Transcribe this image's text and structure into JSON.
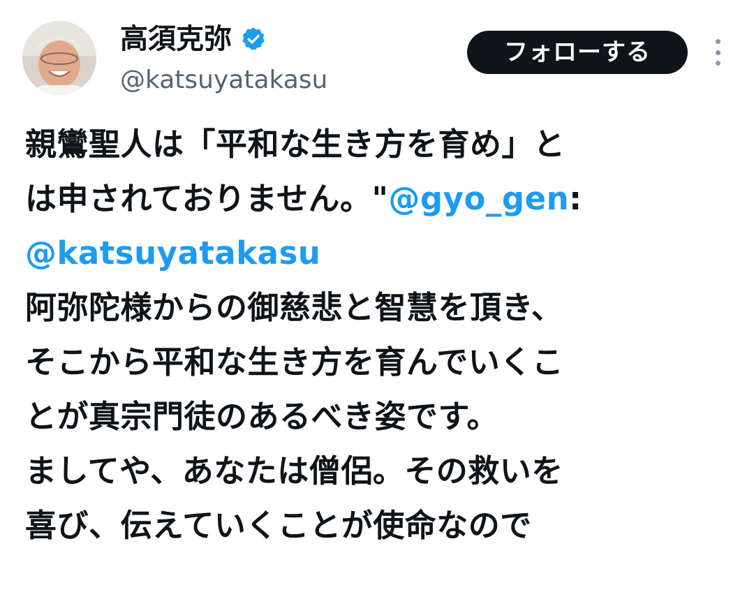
{
  "tweet": {
    "author": {
      "display_name": "高須克弥",
      "handle": "@katsuyatakasu",
      "verified": true,
      "avatar_icon": "profile-photo"
    },
    "follow_label": "フォローする",
    "more_icon": "more-vertical-icon",
    "body_lines": [
      {
        "segments": [
          {
            "text": "親鸞聖人は「平和な生き方を育め」と"
          }
        ]
      },
      {
        "segments": [
          {
            "text": "は申されておりません。\""
          },
          {
            "text": "@gyo_gen",
            "mention": true
          },
          {
            "text": ":"
          }
        ]
      },
      {
        "segments": [
          {
            "text": "@katsuyatakasu",
            "mention": true
          }
        ]
      },
      {
        "segments": [
          {
            "text": "阿弥陀様からの御慈悲と智慧を頂き、"
          }
        ]
      },
      {
        "segments": [
          {
            "text": "そこから平和な生き方を育んでいくこ"
          }
        ]
      },
      {
        "segments": [
          {
            "text": "とが真宗門徒のあるべき姿です。"
          }
        ]
      },
      {
        "segments": [
          {
            "text": "ましてや、あなたは僧侶。その救いを"
          }
        ]
      },
      {
        "segments": [
          {
            "text": "喜び、伝えていくことが使命なので"
          }
        ]
      }
    ]
  },
  "colors": {
    "text": "#0f1419",
    "secondary_text": "#536471",
    "mention": "#1d9bf0",
    "verified_badge": "#1d9bf0",
    "follow_button_bg": "#0f1419",
    "follow_button_text": "#ffffff"
  }
}
